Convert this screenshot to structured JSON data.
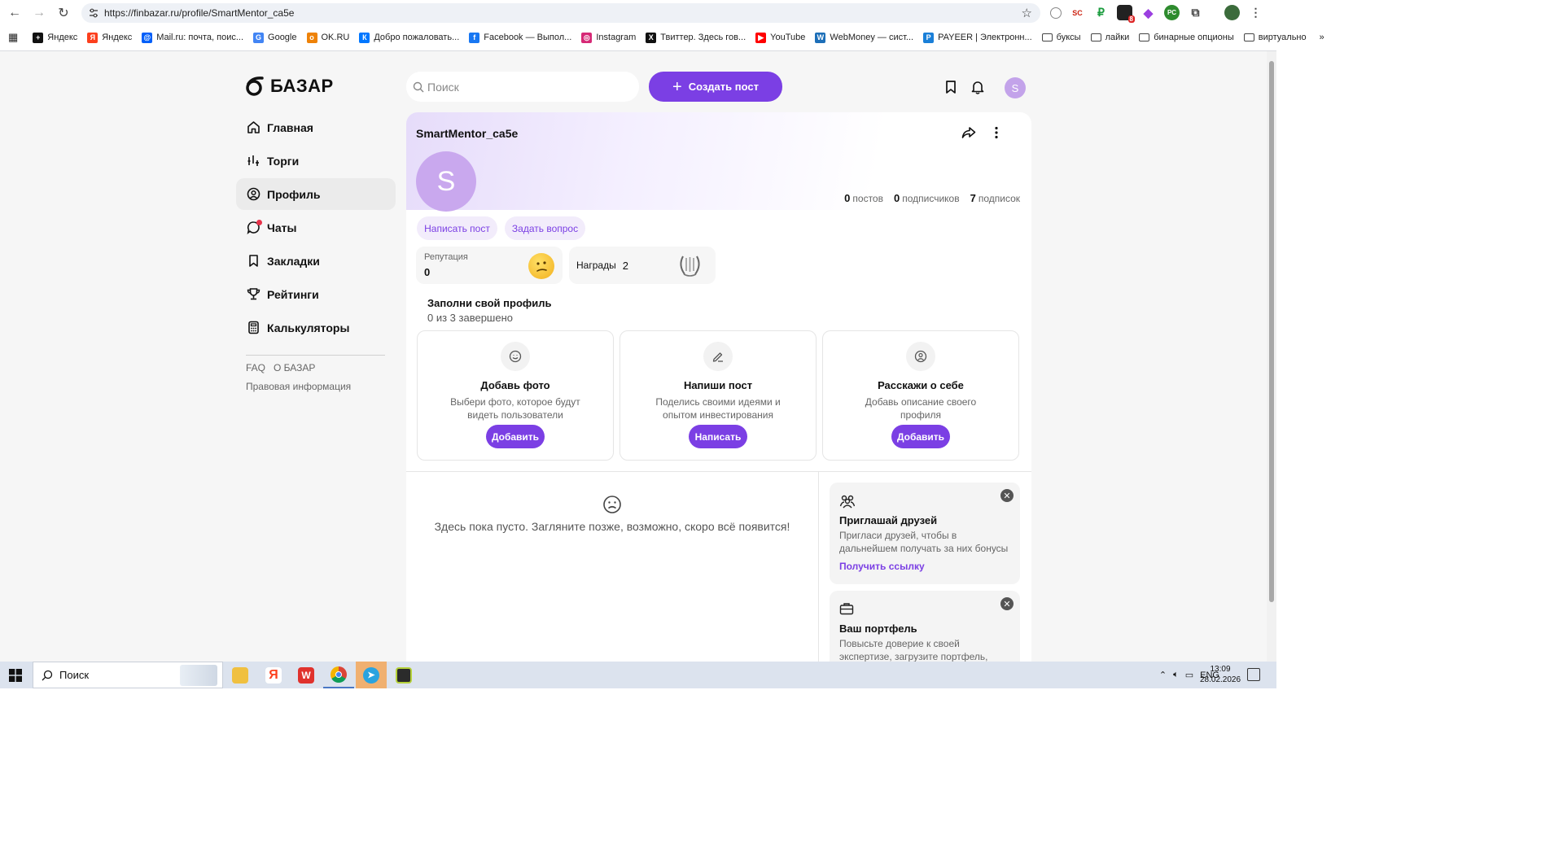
{
  "browser": {
    "url": "https://finbazar.ru/profile/SmartMentor_ca5e",
    "bookmarks": [
      {
        "label": "Яндекс",
        "color": "#111111",
        "glyph": "+"
      },
      {
        "label": "Яндекс",
        "color": "#fc3f1d",
        "glyph": "Я"
      },
      {
        "label": "Mail.ru: почта, поис...",
        "color": "#005ff9",
        "glyph": "@"
      },
      {
        "label": "Google",
        "color": "#4285f4",
        "glyph": "G"
      },
      {
        "label": "OK.RU",
        "color": "#ee8208",
        "glyph": "о"
      },
      {
        "label": "Добро пожаловать...",
        "color": "#0077ff",
        "glyph": "К"
      },
      {
        "label": "Facebook — Выпол...",
        "color": "#1877f2",
        "glyph": "f"
      },
      {
        "label": "Instagram",
        "color": "#d62976",
        "glyph": "◎"
      },
      {
        "label": "Твиттер. Здесь гов...",
        "color": "#111111",
        "glyph": "X"
      },
      {
        "label": "YouTube",
        "color": "#ff0000",
        "glyph": "▶"
      },
      {
        "label": "WebMoney — сист...",
        "color": "#1d6fb8",
        "glyph": "W"
      },
      {
        "label": "PAYEER | Электронн...",
        "color": "#1a7fd8",
        "glyph": "P"
      }
    ],
    "folders": [
      "буксы",
      "лайки",
      "бинарные опционы",
      "виртуально"
    ]
  },
  "sidebar": {
    "logo_text": "БАЗАР",
    "items": [
      {
        "label": "Главная",
        "icon": "home-icon"
      },
      {
        "label": "Торги",
        "icon": "chart-icon"
      },
      {
        "label": "Профиль",
        "icon": "user-icon"
      },
      {
        "label": "Чаты",
        "icon": "chat-icon"
      },
      {
        "label": "Закладки",
        "icon": "bookmark-icon"
      },
      {
        "label": "Рейтинги",
        "icon": "trophy-icon"
      },
      {
        "label": "Калькуляторы",
        "icon": "calculator-icon"
      }
    ],
    "footer": {
      "faq": "FAQ",
      "about": "О БАЗАР",
      "legal": "Правовая информация"
    }
  },
  "header": {
    "search_placeholder": "Поиск",
    "create_label": "Создать пост",
    "avatar_letter": "S"
  },
  "profile": {
    "username": "SmartMentor_ca5e",
    "avatar_letter": "S",
    "stats": {
      "posts_count": "0",
      "posts_label": "постов",
      "subscribers_count": "0",
      "subscribers_label": "подписчиков",
      "subscriptions_count": "7",
      "subscriptions_label": "подписок"
    },
    "write_post_label": "Написать пост",
    "ask_question_label": "Задать вопрос",
    "reputation_label": "Репутация",
    "reputation_value": "0",
    "awards_label": "Награды",
    "awards_value": "2"
  },
  "fill_profile": {
    "title": "Заполни свой профиль",
    "progress": "0 из 3 завершено",
    "cards": [
      {
        "title": "Добавь фото",
        "desc": "Выбери фото, которое будут видеть пользователи",
        "button": "Добавить",
        "icon": "smile-icon"
      },
      {
        "title": "Напиши пост",
        "desc": "Поделись своими идеями и опытом инвестирования",
        "button": "Написать",
        "icon": "pen-icon"
      },
      {
        "title": "Расскажи о себе",
        "desc": "Добавь описание своего профиля",
        "button": "Добавить",
        "icon": "person-icon"
      }
    ]
  },
  "feed": {
    "empty_text": "Здесь пока пусто. Загляните позже, возможно, скоро всё появится!"
  },
  "promos": [
    {
      "title": "Приглашай друзей",
      "desc": "Пригласи друзей, чтобы в дальнейшем получать за них бонусы",
      "link": "Получить ссылку"
    },
    {
      "title": "Ваш портфель",
      "desc": "Повысьте доверие к своей экспертизе, загрузите портфель,",
      "link": ""
    }
  ],
  "taskbar": {
    "search_label": "Поиск",
    "lang": "ENG",
    "time": "13:09",
    "date": "28.02.2026"
  },
  "colors": {
    "accent": "#7b3fe4",
    "accent_soft": "#f2ecfb",
    "avatar": "#c9a8ee"
  }
}
